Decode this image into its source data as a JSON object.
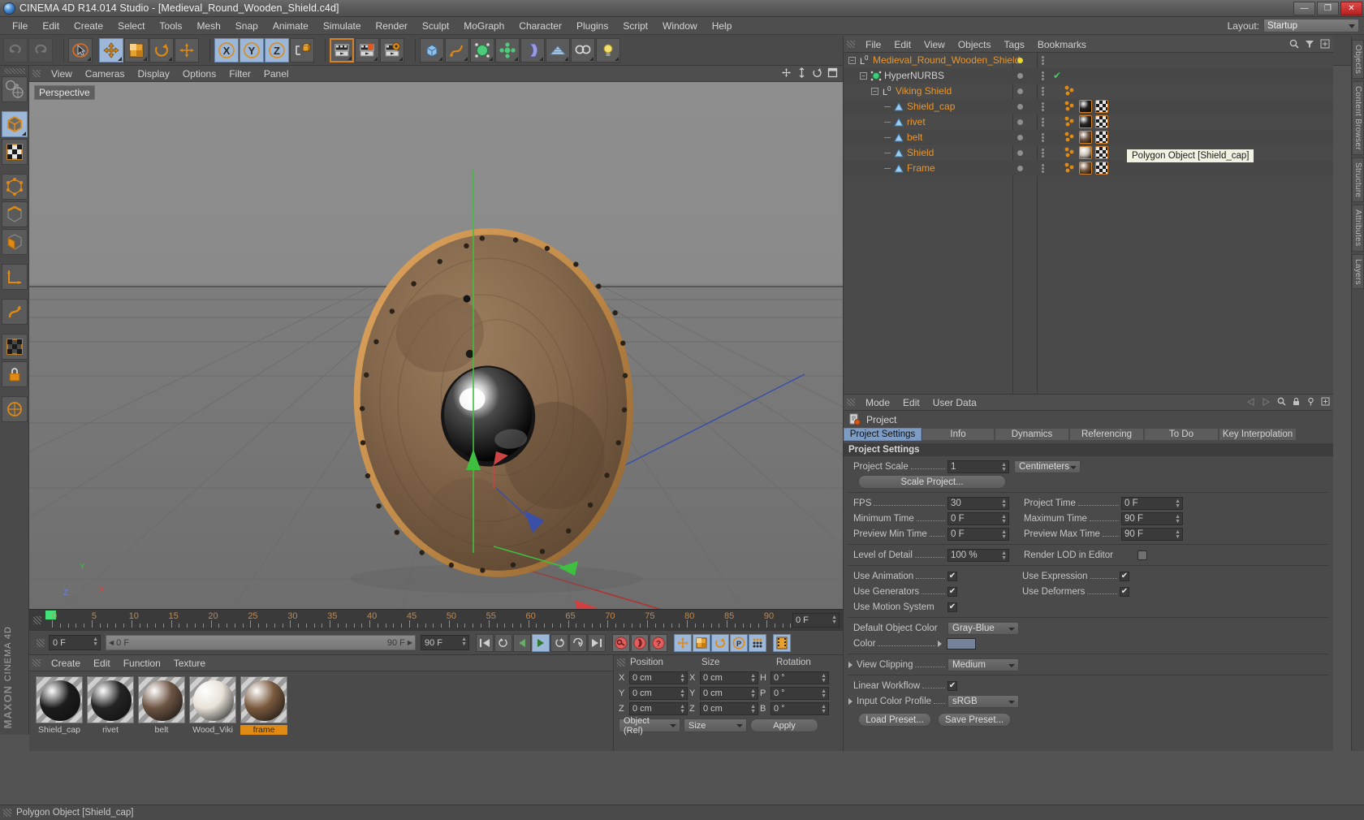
{
  "window": {
    "title": "CINEMA 4D R14.014 Studio - [Medieval_Round_Wooden_Shield.c4d]",
    "minimize": "—",
    "maximize": "❐",
    "close": "✕"
  },
  "menubar": {
    "items": [
      "File",
      "Edit",
      "Create",
      "Select",
      "Tools",
      "Mesh",
      "Snap",
      "Animate",
      "Simulate",
      "Render",
      "Sculpt",
      "MoGraph",
      "Character",
      "Plugins",
      "Script",
      "Window",
      "Help"
    ],
    "layout_label": "Layout:",
    "layout_value": "Startup"
  },
  "toolbar": {
    "undo": "undo-icon",
    "redo": "redo-icon",
    "live_selection": "live-selection-icon",
    "move": "move-icon",
    "scale": "scale-icon",
    "rotate": "rotate-icon",
    "move_axis": "move-axis-icon",
    "lock_x": "X",
    "lock_y": "Y",
    "lock_z": "Z",
    "world_object": "world-coordinate-icon",
    "render_view": "render-view-icon",
    "render_region": "render-region-icon",
    "render_settings": "render-settings-icon",
    "cube": "cube-primitive-icon",
    "spline": "spline-pen-icon",
    "nurbs": "hypernurbs-icon",
    "array": "array-icon",
    "bend": "bend-deformer-icon",
    "floor": "floor-icon",
    "camera": "camera-icon",
    "light": "light-icon"
  },
  "left_tools": {
    "items": [
      {
        "name": "undo-view-icon",
        "active": false
      },
      {
        "name": "object-mode-icon",
        "active": true
      },
      {
        "name": "texture-mode-icon",
        "active": false
      },
      {
        "name": "point-mode-icon",
        "active": false
      },
      {
        "name": "edge-mode-icon",
        "active": false
      },
      {
        "name": "polygon-mode-icon",
        "active": false
      },
      {
        "name": "axis-mode-icon",
        "active": false
      },
      {
        "name": "enable-axis-icon",
        "active": false
      },
      {
        "name": "viewport-solo-icon",
        "active": false
      },
      {
        "name": "lock-icon",
        "active": false
      },
      {
        "name": "workplane-icon",
        "active": false
      }
    ],
    "brand_maxon": "MAXON",
    "brand_c4d": "CINEMA 4D"
  },
  "viewport": {
    "menus": [
      "View",
      "Cameras",
      "Display",
      "Options",
      "Filter",
      "Panel"
    ],
    "label": "Perspective",
    "axis_x": "X",
    "axis_y": "Y",
    "axis_z": "Z"
  },
  "timeline": {
    "ticks": [
      0,
      5,
      10,
      15,
      20,
      25,
      30,
      35,
      40,
      45,
      50,
      55,
      60,
      65,
      70,
      75,
      80,
      85,
      90
    ],
    "current_frame": "0 F"
  },
  "powerslider": {
    "current": "0 F",
    "range_start": "0 F",
    "range_end": "90 F",
    "end_field": "90 F",
    "buttons": [
      "go-to-start-icon",
      "go-to-previous-key-icon",
      "play-backwards-icon",
      "play-forwards-icon",
      "go-to-next-key-icon",
      "loop-icon",
      "go-to-end-icon",
      "record-active-objects-icon",
      "autokeying-icon",
      "keyframe-selection-icon",
      "position-key-icon",
      "scale-key-icon",
      "rotation-key-icon",
      "parameter-key-icon",
      "point-level-animation-icon",
      "animation-mode-icon"
    ]
  },
  "material_manager": {
    "menus": [
      "Create",
      "Edit",
      "Function",
      "Texture"
    ],
    "materials": [
      {
        "name": "Shield_cap",
        "selected": false,
        "color": "#1c1c1c"
      },
      {
        "name": "rivet",
        "selected": false,
        "color": "#242424"
      },
      {
        "name": "belt",
        "selected": false,
        "color": "#6d5443"
      },
      {
        "name": "Wood_Viki",
        "selected": false,
        "color": "#e8e2d8"
      },
      {
        "name": "frame",
        "selected": true,
        "color": "#7a5a3e"
      }
    ]
  },
  "coordinates": {
    "headers": [
      "Position",
      "Size",
      "Rotation"
    ],
    "rows": [
      {
        "p_axis": "X",
        "p_val": "0 cm",
        "s_axis": "X",
        "s_val": "0 cm",
        "r_axis": "H",
        "r_val": "0 °"
      },
      {
        "p_axis": "Y",
        "p_val": "0 cm",
        "s_axis": "Y",
        "s_val": "0 cm",
        "r_axis": "P",
        "r_val": "0 °"
      },
      {
        "p_axis": "Z",
        "p_val": "0 cm",
        "s_axis": "Z",
        "s_val": "0 cm",
        "r_axis": "B",
        "r_val": "0 °"
      }
    ],
    "mode": "Object (Rel)",
    "size_mode": "Size",
    "apply": "Apply"
  },
  "object_manager": {
    "menus": [
      "File",
      "Edit",
      "View",
      "Objects",
      "Tags",
      "Bookmarks"
    ],
    "objects": [
      {
        "name": "Medieval_Round_Wooden_Shield",
        "depth": 0,
        "icon": "null-object-icon",
        "color": "#e8962d",
        "has_expand": true,
        "dot_color": "#e8d832",
        "check": false,
        "tags": []
      },
      {
        "name": "HyperNURBS",
        "depth": 1,
        "icon": "hypernurbs-icon",
        "color": "#cfcfcf",
        "has_expand": true,
        "dot_color": "#8f8f8f",
        "check": true,
        "tags": []
      },
      {
        "name": "Viking Shield",
        "depth": 2,
        "icon": "null-object-icon",
        "color": "#e8962d",
        "has_expand": true,
        "dot_color": "#8f8f8f",
        "check": false,
        "tags": [
          "dots"
        ]
      },
      {
        "name": "Shield_cap",
        "depth": 3,
        "icon": "polygon-object-icon",
        "color": "#e8962d",
        "has_expand": false,
        "dot_color": "#8f8f8f",
        "check": false,
        "tags": [
          "dots",
          "mat",
          "uv"
        ],
        "mat_color": "#221f1e"
      },
      {
        "name": "rivet",
        "depth": 3,
        "icon": "polygon-object-icon",
        "color": "#e8962d",
        "has_expand": false,
        "dot_color": "#8f8f8f",
        "check": false,
        "tags": [
          "dots",
          "mat",
          "uv"
        ],
        "mat_color": "#2a2725"
      },
      {
        "name": "belt",
        "depth": 3,
        "icon": "polygon-object-icon",
        "color": "#e8962d",
        "has_expand": false,
        "dot_color": "#8f8f8f",
        "check": false,
        "tags": [
          "dots",
          "mat",
          "uv"
        ],
        "mat_color": "#6d5443"
      },
      {
        "name": "Shield",
        "depth": 3,
        "icon": "polygon-object-icon",
        "color": "#e8962d",
        "has_expand": false,
        "dot_color": "#8f8f8f",
        "check": false,
        "tags": [
          "dots",
          "mat",
          "uv"
        ],
        "mat_color": "#cfc6ba"
      },
      {
        "name": "Frame",
        "depth": 3,
        "icon": "polygon-object-icon",
        "color": "#e8962d",
        "has_expand": false,
        "dot_color": "#8f8f8f",
        "check": false,
        "tags": [
          "dots",
          "mat",
          "uv"
        ],
        "mat_color": "#7a5a3e"
      }
    ],
    "tooltip": "Polygon Object [Shield_cap]"
  },
  "attribute_manager": {
    "menus": [
      "Mode",
      "Edit",
      "User Data"
    ],
    "object_title": "Project",
    "tabs": [
      {
        "label": "Project Settings",
        "active": true
      },
      {
        "label": "Info",
        "active": false
      },
      {
        "label": "Dynamics",
        "active": false
      },
      {
        "label": "Referencing",
        "active": false
      },
      {
        "label": "To Do",
        "active": false
      },
      {
        "label": "Key Interpolation",
        "active": false
      }
    ],
    "section_title": "Project Settings",
    "project_scale_label": "Project Scale",
    "project_scale_value": "1",
    "project_unit": "Centimeters",
    "scale_project_button": "Scale Project...",
    "fps_label": "FPS",
    "fps_value": "30",
    "project_time_label": "Project Time",
    "project_time_value": "0 F",
    "minimum_time_label": "Minimum Time",
    "minimum_time_value": "0 F",
    "maximum_time_label": "Maximum Time",
    "maximum_time_value": "90 F",
    "preview_min_label": "Preview Min Time",
    "preview_min_value": "0 F",
    "preview_max_label": "Preview Max Time",
    "preview_max_value": "90 F",
    "lod_label": "Level of Detail",
    "lod_value": "100 %",
    "render_lod_label": "Render LOD in Editor",
    "render_lod_checked": false,
    "use_animation_label": "Use Animation",
    "use_animation_checked": true,
    "use_expression_label": "Use Expression",
    "use_expression_checked": true,
    "use_generators_label": "Use Generators",
    "use_generators_checked": true,
    "use_deformers_label": "Use Deformers",
    "use_deformers_checked": true,
    "use_motion_label": "Use Motion System",
    "use_motion_checked": true,
    "default_color_label": "Default Object Color",
    "default_color_value": "Gray-Blue",
    "color_label": "Color",
    "color_swatch": "#75839a",
    "view_clipping_label": "View Clipping",
    "view_clipping_value": "Medium",
    "linear_workflow_label": "Linear Workflow",
    "linear_workflow_checked": true,
    "input_profile_label": "Input Color Profile",
    "input_profile_value": "sRGB",
    "load_preset": "Load Preset...",
    "save_preset": "Save Preset..."
  },
  "right_tabs": [
    "Objects",
    "Content Browser",
    "Structure",
    "Attributes",
    "Layers"
  ],
  "statusbar": {
    "text": "Polygon Object [Shield_cap]"
  }
}
